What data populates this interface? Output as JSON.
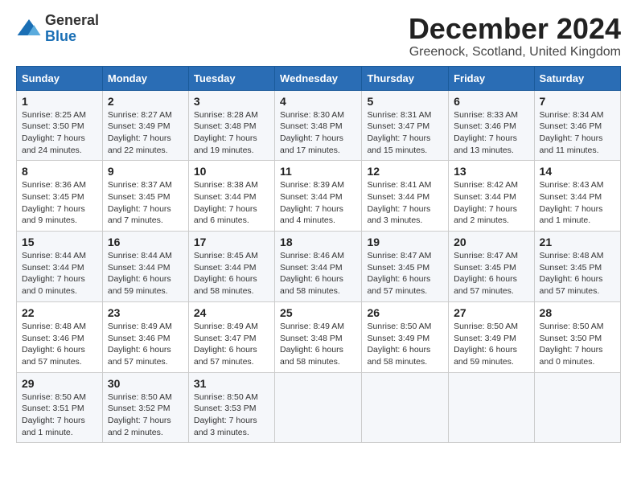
{
  "logo": {
    "general": "General",
    "blue": "Blue"
  },
  "title": "December 2024",
  "subtitle": "Greenock, Scotland, United Kingdom",
  "headers": [
    "Sunday",
    "Monday",
    "Tuesday",
    "Wednesday",
    "Thursday",
    "Friday",
    "Saturday"
  ],
  "weeks": [
    [
      {
        "day": "1",
        "sunrise": "8:25 AM",
        "sunset": "3:50 PM",
        "daylight": "7 hours and 24 minutes."
      },
      {
        "day": "2",
        "sunrise": "8:27 AM",
        "sunset": "3:49 PM",
        "daylight": "7 hours and 22 minutes."
      },
      {
        "day": "3",
        "sunrise": "8:28 AM",
        "sunset": "3:48 PM",
        "daylight": "7 hours and 19 minutes."
      },
      {
        "day": "4",
        "sunrise": "8:30 AM",
        "sunset": "3:48 PM",
        "daylight": "7 hours and 17 minutes."
      },
      {
        "day": "5",
        "sunrise": "8:31 AM",
        "sunset": "3:47 PM",
        "daylight": "7 hours and 15 minutes."
      },
      {
        "day": "6",
        "sunrise": "8:33 AM",
        "sunset": "3:46 PM",
        "daylight": "7 hours and 13 minutes."
      },
      {
        "day": "7",
        "sunrise": "8:34 AM",
        "sunset": "3:46 PM",
        "daylight": "7 hours and 11 minutes."
      }
    ],
    [
      {
        "day": "8",
        "sunrise": "8:36 AM",
        "sunset": "3:45 PM",
        "daylight": "7 hours and 9 minutes."
      },
      {
        "day": "9",
        "sunrise": "8:37 AM",
        "sunset": "3:45 PM",
        "daylight": "7 hours and 7 minutes."
      },
      {
        "day": "10",
        "sunrise": "8:38 AM",
        "sunset": "3:44 PM",
        "daylight": "7 hours and 6 minutes."
      },
      {
        "day": "11",
        "sunrise": "8:39 AM",
        "sunset": "3:44 PM",
        "daylight": "7 hours and 4 minutes."
      },
      {
        "day": "12",
        "sunrise": "8:41 AM",
        "sunset": "3:44 PM",
        "daylight": "7 hours and 3 minutes."
      },
      {
        "day": "13",
        "sunrise": "8:42 AM",
        "sunset": "3:44 PM",
        "daylight": "7 hours and 2 minutes."
      },
      {
        "day": "14",
        "sunrise": "8:43 AM",
        "sunset": "3:44 PM",
        "daylight": "7 hours and 1 minute."
      }
    ],
    [
      {
        "day": "15",
        "sunrise": "8:44 AM",
        "sunset": "3:44 PM",
        "daylight": "7 hours and 0 minutes."
      },
      {
        "day": "16",
        "sunrise": "8:44 AM",
        "sunset": "3:44 PM",
        "daylight": "6 hours and 59 minutes."
      },
      {
        "day": "17",
        "sunrise": "8:45 AM",
        "sunset": "3:44 PM",
        "daylight": "6 hours and 58 minutes."
      },
      {
        "day": "18",
        "sunrise": "8:46 AM",
        "sunset": "3:44 PM",
        "daylight": "6 hours and 58 minutes."
      },
      {
        "day": "19",
        "sunrise": "8:47 AM",
        "sunset": "3:45 PM",
        "daylight": "6 hours and 57 minutes."
      },
      {
        "day": "20",
        "sunrise": "8:47 AM",
        "sunset": "3:45 PM",
        "daylight": "6 hours and 57 minutes."
      },
      {
        "day": "21",
        "sunrise": "8:48 AM",
        "sunset": "3:45 PM",
        "daylight": "6 hours and 57 minutes."
      }
    ],
    [
      {
        "day": "22",
        "sunrise": "8:48 AM",
        "sunset": "3:46 PM",
        "daylight": "6 hours and 57 minutes."
      },
      {
        "day": "23",
        "sunrise": "8:49 AM",
        "sunset": "3:46 PM",
        "daylight": "6 hours and 57 minutes."
      },
      {
        "day": "24",
        "sunrise": "8:49 AM",
        "sunset": "3:47 PM",
        "daylight": "6 hours and 57 minutes."
      },
      {
        "day": "25",
        "sunrise": "8:49 AM",
        "sunset": "3:48 PM",
        "daylight": "6 hours and 58 minutes."
      },
      {
        "day": "26",
        "sunrise": "8:50 AM",
        "sunset": "3:49 PM",
        "daylight": "6 hours and 58 minutes."
      },
      {
        "day": "27",
        "sunrise": "8:50 AM",
        "sunset": "3:49 PM",
        "daylight": "6 hours and 59 minutes."
      },
      {
        "day": "28",
        "sunrise": "8:50 AM",
        "sunset": "3:50 PM",
        "daylight": "7 hours and 0 minutes."
      }
    ],
    [
      {
        "day": "29",
        "sunrise": "8:50 AM",
        "sunset": "3:51 PM",
        "daylight": "7 hours and 1 minute."
      },
      {
        "day": "30",
        "sunrise": "8:50 AM",
        "sunset": "3:52 PM",
        "daylight": "7 hours and 2 minutes."
      },
      {
        "day": "31",
        "sunrise": "8:50 AM",
        "sunset": "3:53 PM",
        "daylight": "7 hours and 3 minutes."
      },
      null,
      null,
      null,
      null
    ]
  ]
}
